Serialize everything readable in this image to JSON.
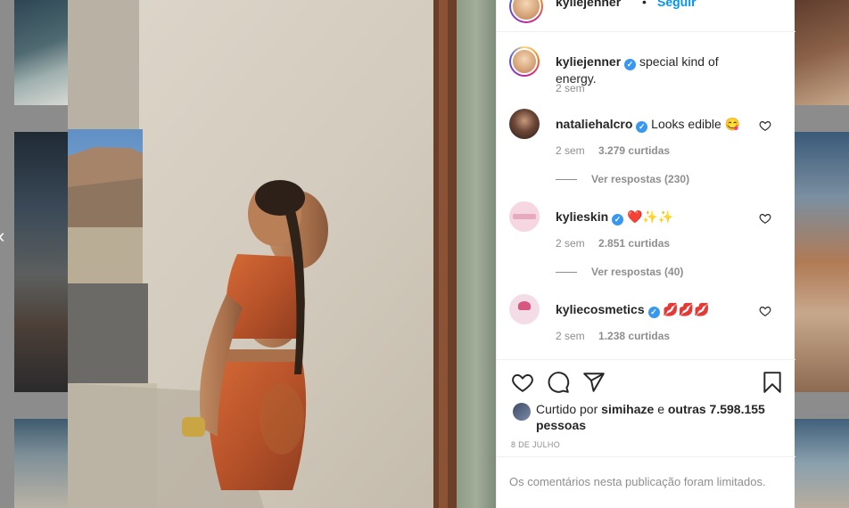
{
  "header": {
    "username": "kyliejenner",
    "separator": "•",
    "follow_label": "Seguir",
    "more_label": "•••"
  },
  "caption": {
    "username": "kyliejenner",
    "text": "special kind of energy.",
    "time": "2 sem"
  },
  "comments": [
    {
      "username": "nataliehalcro",
      "text": "Looks edible 😋",
      "time": "2 sem",
      "likes": "3.279 curtidas",
      "replies": "Ver respostas (230)"
    },
    {
      "username": "kylieskin",
      "text": "❤️✨✨",
      "time": "2 sem",
      "likes": "2.851 curtidas",
      "replies": "Ver respostas (40)"
    },
    {
      "username": "kyliecosmetics",
      "text": "💋💋💋",
      "time": "2 sem",
      "likes": "1.238 curtidas"
    }
  ],
  "likes_summary": {
    "prefix": "Curtido por",
    "user": "simihaze",
    "conjunction": "e",
    "others": "outras 7.598.155 pessoas"
  },
  "post_date": "8 DE JULHO",
  "limited_notice": "Os comentários nesta publicação foram limitados.",
  "icons": {
    "verified": "verified-badge",
    "like": "heart-outline-icon",
    "comment": "comment-bubble-icon",
    "share": "paper-plane-icon",
    "save": "bookmark-icon"
  },
  "colors": {
    "accent": "#0095f6",
    "verified": "#3897f0",
    "muted_text": "#8e8e8e",
    "text": "#262626"
  }
}
